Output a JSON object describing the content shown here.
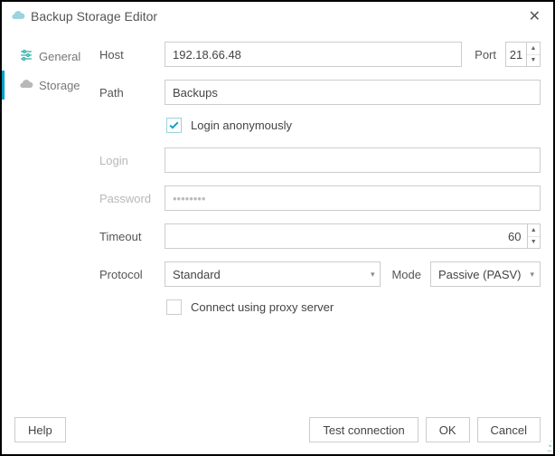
{
  "title": "Backup Storage Editor",
  "sidebar": {
    "items": [
      {
        "label": "General"
      },
      {
        "label": "Storage"
      }
    ]
  },
  "form": {
    "host_label": "Host",
    "host_value": "192.18.66.48",
    "port_label": "Port",
    "port_value": "21",
    "path_label": "Path",
    "path_value": "Backups",
    "login_anon_label": "Login anonymously",
    "login_anon_checked": true,
    "login_label": "Login",
    "login_value": "",
    "password_label": "Password",
    "password_value": "••••••••",
    "timeout_label": "Timeout",
    "timeout_value": "60",
    "protocol_label": "Protocol",
    "protocol_value": "Standard",
    "mode_label": "Mode",
    "mode_value": "Passive (PASV)",
    "proxy_label": "Connect using proxy server",
    "proxy_checked": false
  },
  "footer": {
    "help": "Help",
    "test": "Test connection",
    "ok": "OK",
    "cancel": "Cancel"
  }
}
